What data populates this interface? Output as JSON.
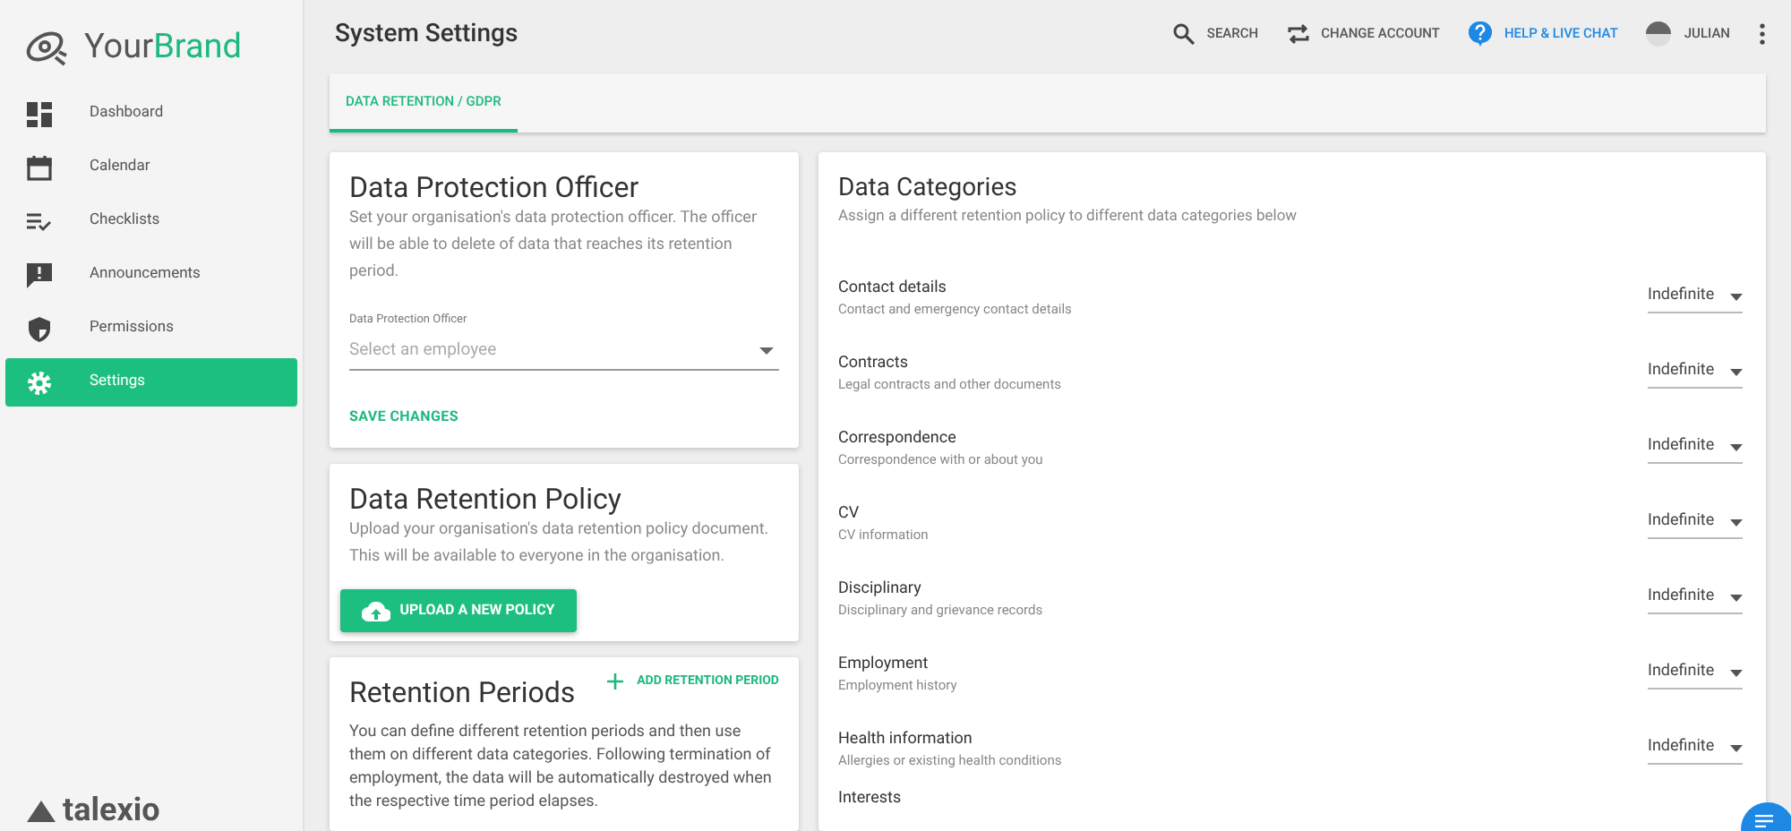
{
  "brand": {
    "name_part_1": "Your",
    "name_part_2": "Brand"
  },
  "sidebar": {
    "items": [
      {
        "label": "Dashboard",
        "kind": "dashboard",
        "selected": false
      },
      {
        "label": "Calendar",
        "kind": "calendar",
        "selected": false
      },
      {
        "label": "Checklists",
        "kind": "checklist",
        "selected": false
      },
      {
        "label": "Announcements",
        "kind": "announcement",
        "selected": false
      },
      {
        "label": "Permissions",
        "kind": "shield",
        "selected": false
      },
      {
        "label": "Settings",
        "kind": "gear",
        "selected": true
      }
    ],
    "footer_logo": "talexio"
  },
  "header": {
    "title": "System Settings",
    "actions": [
      {
        "label": "SEARCH",
        "kind": "search"
      },
      {
        "label": "CHANGE ACCOUNT",
        "kind": "swap"
      },
      {
        "label": "HELP & LIVE CHAT",
        "kind": "help"
      },
      {
        "label": "JULIAN",
        "kind": "user"
      }
    ]
  },
  "tabs": [
    {
      "label": "DATA RETENTION / GDPR",
      "selected": true
    }
  ],
  "dpo_card": {
    "title": "Data Protection Officer",
    "description": "Set your organisation's data protection officer. The officer will be able to delete of data that reaches its retention period.",
    "field": {
      "label": "Data Protection Officer",
      "placeholder": "Select an employee"
    },
    "save_button": "SAVE CHANGES"
  },
  "policy_card": {
    "title": "Data Retention Policy",
    "description": "Upload your organisation's data retention policy document. This will be available to everyone in the organisation.",
    "upload_button": "UPLOAD A NEW POLICY"
  },
  "periods_card": {
    "title": "Retention Periods",
    "add_button": "ADD RETENTION PERIOD",
    "description": "You can define different retention periods and then use them on different data categories. Following termination of employment, the data will be automatically destroyed when the respective time period elapses."
  },
  "categories_card": {
    "title": "Data Categories",
    "description": "Assign a different retention policy to different data categories below",
    "rows": [
      {
        "name": "Contact details",
        "description": "Contact and emergency contact details",
        "value": "Indefinite"
      },
      {
        "name": "Contracts",
        "description": "Legal contracts and other documents",
        "value": "Indefinite"
      },
      {
        "name": "Correspondence",
        "description": "Correspondence with or about you",
        "value": "Indefinite"
      },
      {
        "name": "CV",
        "description": "CV information",
        "value": "Indefinite"
      },
      {
        "name": "Disciplinary",
        "description": "Disciplinary and grievance records",
        "value": "Indefinite"
      },
      {
        "name": "Employment",
        "description": "Employment history",
        "value": "Indefinite"
      },
      {
        "name": "Health information",
        "description": "Allergies or existing health conditions",
        "value": "Indefinite"
      },
      {
        "name": "Interests"
      }
    ]
  }
}
